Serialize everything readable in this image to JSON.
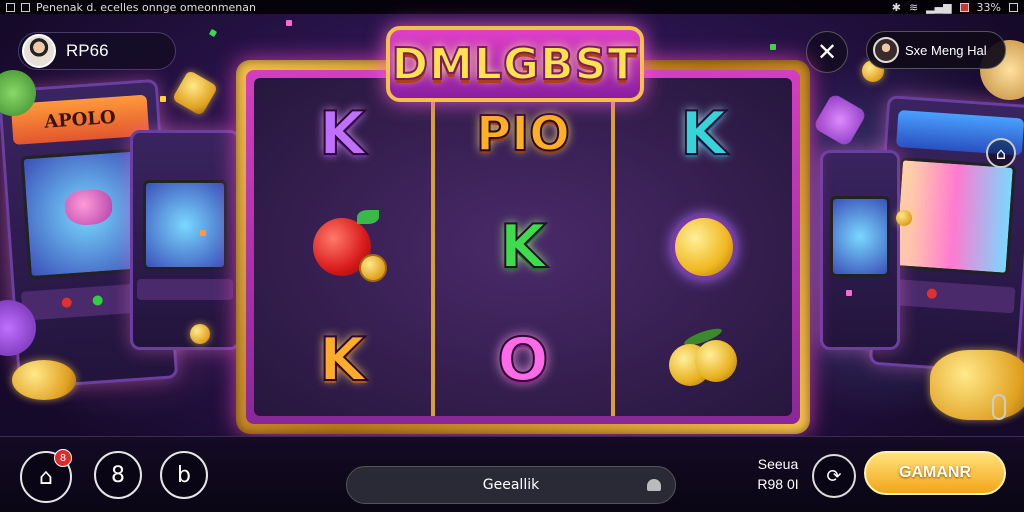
{
  "status_bar": {
    "left_text": "Penenak  d.  ecelles  onnge  omeonmenan",
    "right_text": "33%"
  },
  "player": {
    "name": "RP66",
    "avatar_icon": "user-avatar"
  },
  "top_right": {
    "close_symbol": "✕",
    "menu_label": "Sxe Meng Hal"
  },
  "game": {
    "title": "DMLGBST",
    "reels": [
      [
        {
          "kind": "letter",
          "text": "K",
          "style": "purple"
        },
        {
          "kind": "fruit"
        },
        {
          "kind": "letter",
          "text": "K",
          "style": "orange"
        }
      ],
      [
        {
          "kind": "letter",
          "text": "PIO",
          "style": "pio"
        },
        {
          "kind": "letter",
          "text": "K",
          "style": "green"
        },
        {
          "kind": "letter",
          "text": "O",
          "style": "pink"
        }
      ],
      [
        {
          "kind": "letter",
          "text": "K",
          "style": "teal"
        },
        {
          "kind": "coin"
        },
        {
          "kind": "golden-fruit"
        }
      ]
    ]
  },
  "background": {
    "cabinet_left_marquee": "APOLO",
    "colors": {
      "accent": "#f5c04a",
      "frame": "#d23fc0",
      "bg": "#1a0f2e"
    }
  },
  "bottom_bar": {
    "home_badge": "8",
    "icon2": "8",
    "icon3": "b",
    "search_label": "Geeallik",
    "bet_line1": "Seeua",
    "bet_line2": "R98 0I",
    "cta_label": "GAMANR"
  }
}
